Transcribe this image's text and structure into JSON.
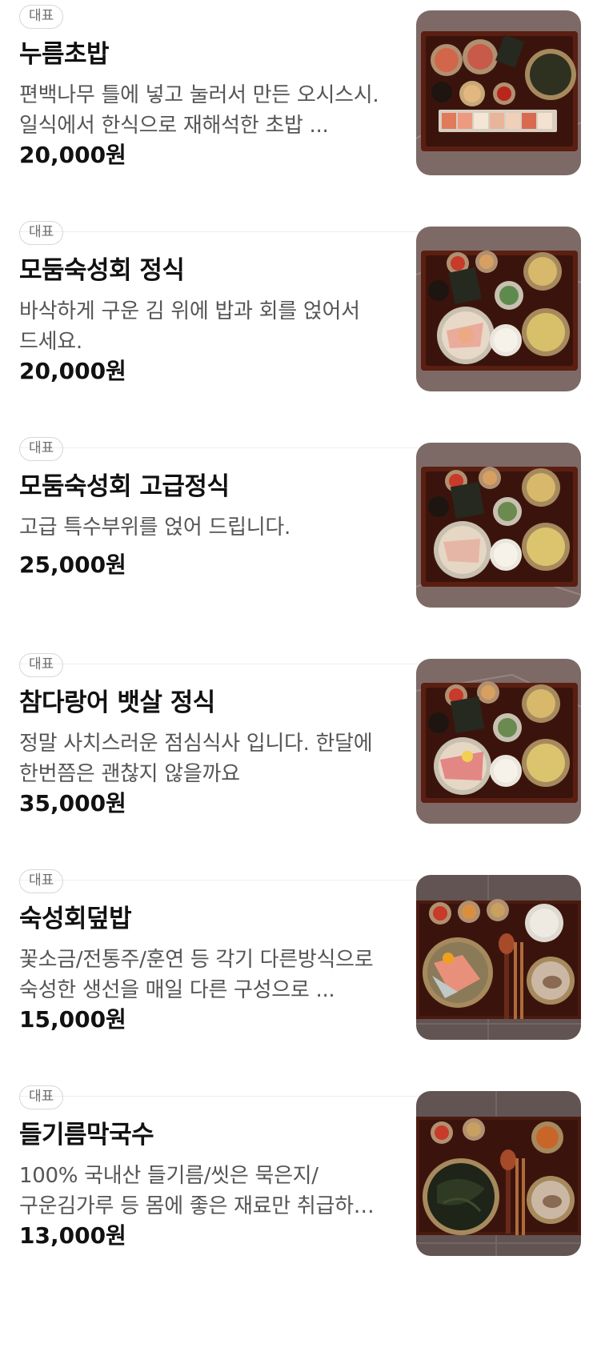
{
  "menu": {
    "items": [
      {
        "badge": "대표",
        "name": "누름초밥",
        "description": "편백나무 틀에 넣고 눌러서 만든 오시스시. 일식에서 한식으로 재해석한 초밥 ...",
        "price": "20,000원",
        "image": "pressed-sushi-set-photo"
      },
      {
        "badge": "대표",
        "name": "모둠숙성회 정식",
        "description": "바삭하게 구운 김 위에 밥과 회를 얹어서 드세요.",
        "price": "20,000원",
        "image": "aged-sashimi-set-meal-photo"
      },
      {
        "badge": "대표",
        "name": "모둠숙성회 고급정식",
        "description": "고급 특수부위를 얹어 드립니다.",
        "price": "25,000원",
        "image": "premium-aged-sashimi-set-photo"
      },
      {
        "badge": "대표",
        "name": "참다랑어 뱃살 정식",
        "description": "정말 사치스러운 점심식사 입니다. 한달에 한번쯤은 괜찮지 않을까요",
        "price": "35,000원",
        "image": "bluefin-tuna-belly-set-photo"
      },
      {
        "badge": "대표",
        "name": "숙성회덮밥",
        "description": "꽃소금/전통주/훈연 등 각기 다른방식으로 숙성한 생선을 매일 다른 구성으로 ...",
        "price": "15,000원",
        "image": "aged-sashimi-rice-bowl-photo"
      },
      {
        "badge": "대표",
        "name": "들기름막국수",
        "description": "100% 국내산 들기름/씻은 묵은지/구운김가루 등 몸에 좋은 재료만 취급하여 ...",
        "price": "13,000원",
        "image": "perilla-oil-buckwheat-noodles-photo"
      }
    ]
  },
  "colors": {
    "text": "#111111",
    "description": "#555555",
    "badge_border": "#d7d7d7",
    "badge_text": "#6c6c6c",
    "divider": "#eeeeee",
    "tray": "#5a1f12",
    "stone_background": "#7d6a66"
  }
}
